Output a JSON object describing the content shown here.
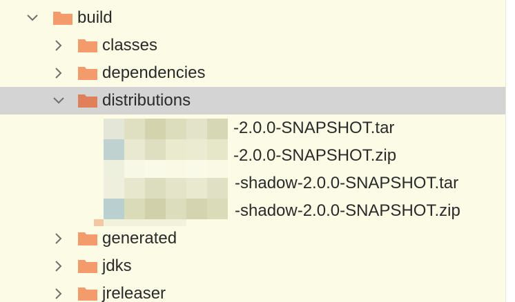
{
  "tree": {
    "build": {
      "label": "build",
      "icon": "folder-open-icon",
      "expanded": true
    },
    "classes": {
      "label": "classes",
      "icon": "folder-icon",
      "expanded": false
    },
    "dependencies": {
      "label": "dependencies",
      "icon": "folder-icon",
      "expanded": false
    },
    "distributions": {
      "label": "distributions",
      "icon": "folder-open-icon",
      "expanded": true,
      "selected": true
    },
    "files": [
      {
        "label": "-2.0.0-SNAPSHOT.tar"
      },
      {
        "label": "-2.0.0-SNAPSHOT.zip"
      },
      {
        "label": "-shadow-2.0.0-SNAPSHOT.tar"
      },
      {
        "label": "-shadow-2.0.0-SNAPSHOT.zip"
      }
    ],
    "generated": {
      "label": "generated",
      "icon": "folder-icon",
      "expanded": false
    },
    "jdks": {
      "label": "jdks",
      "icon": "folder-icon",
      "expanded": false
    },
    "jreleaser": {
      "label": "jreleaser",
      "icon": "folder-icon",
      "expanded": false
    }
  },
  "colors": {
    "background": "#fbfbe6",
    "selection": "#d4d4d4",
    "folder": "#f39b6a",
    "folder_selected": "#e0805a",
    "text": "#2a2a2a",
    "chevron": "#6e6e6e"
  }
}
